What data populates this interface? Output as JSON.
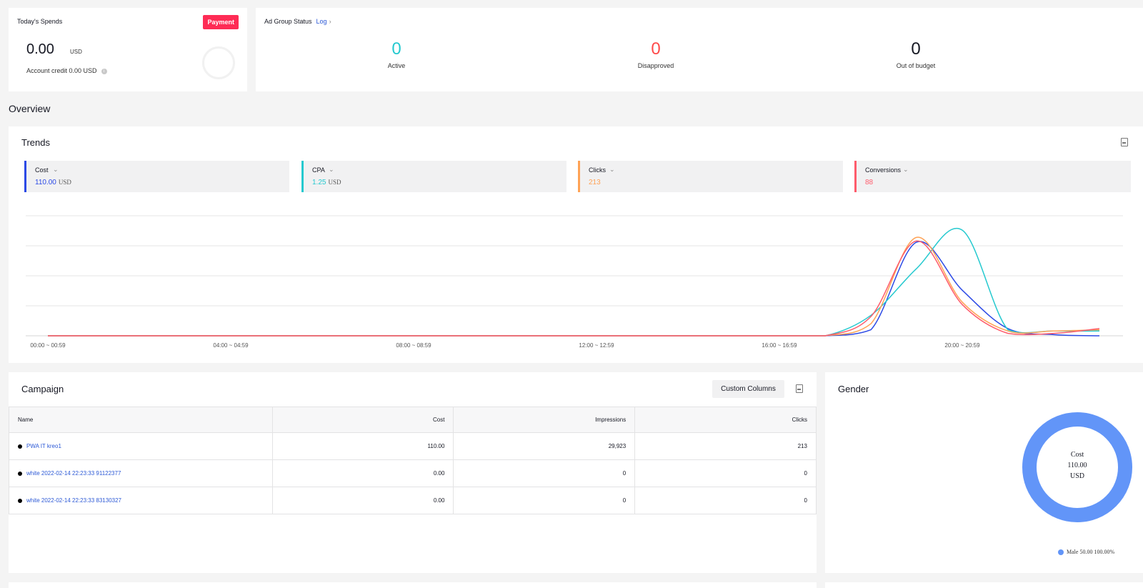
{
  "spend": {
    "title": "Today's Spends",
    "payment_label": "Payment",
    "amount": "0.00",
    "currency": "USD",
    "credit": "Account credit 0.00 USD"
  },
  "status": {
    "title": "Ad Group Status",
    "log_label": "Log",
    "items": [
      {
        "value": "0",
        "label": "Active",
        "color": "#25c9cf"
      },
      {
        "value": "0",
        "label": "Disapproved",
        "color": "#fe4a4a"
      },
      {
        "value": "0",
        "label": "Out of budget",
        "color": "#161823"
      }
    ]
  },
  "overview": {
    "title": "Overview"
  },
  "trends": {
    "title": "Trends",
    "metrics": [
      {
        "name": "Cost",
        "value": "110.00",
        "unit": "USD",
        "color": "#2c4ae6"
      },
      {
        "name": "CPA",
        "value": "1.25",
        "unit": "USD",
        "color": "#25c9cf"
      },
      {
        "name": "Clicks",
        "value": "213",
        "unit": "",
        "color": "#ffa255"
      },
      {
        "name": "Conversions",
        "value": "88",
        "unit": "",
        "color": "#fe5c6c"
      }
    ]
  },
  "chart_data": {
    "type": "line",
    "x_tick_labels": [
      "00:00 ~ 00:59",
      "04:00 ~ 04:59",
      "08:00 ~ 08:59",
      "12:00 ~ 12:59",
      "16:00 ~ 16:59",
      "20:00 ~ 20:59"
    ],
    "x": [
      0,
      1,
      2,
      3,
      4,
      5,
      6,
      7,
      8,
      9,
      10,
      11,
      12,
      13,
      14,
      15,
      16,
      17,
      18,
      19,
      20,
      21,
      22,
      23
    ],
    "grid": true,
    "series": [
      {
        "name": "Cost",
        "color": "#2c4ae6",
        "values": [
          0,
          0,
          0,
          0,
          0,
          0,
          0,
          0,
          0,
          0,
          0,
          0,
          0,
          0,
          0,
          0,
          0,
          0,
          0.05,
          0.78,
          0.38,
          0.06,
          0.01,
          0
        ]
      },
      {
        "name": "CPA",
        "color": "#25c9cf",
        "values": [
          0,
          0,
          0,
          0,
          0,
          0,
          0,
          0,
          0,
          0,
          0,
          0,
          0,
          0,
          0,
          0,
          0,
          0,
          0.17,
          0.56,
          0.88,
          0.05,
          0.04,
          0.04
        ]
      },
      {
        "name": "Clicks",
        "color": "#ffa255",
        "values": [
          0,
          0,
          0,
          0,
          0,
          0,
          0,
          0,
          0,
          0,
          0,
          0,
          0,
          0,
          0,
          0,
          0,
          0,
          0.1,
          0.82,
          0.28,
          0.04,
          0.04,
          0.05
        ]
      },
      {
        "name": "Conversions",
        "color": "#fe5c6c",
        "values": [
          0,
          0,
          0,
          0,
          0,
          0,
          0,
          0,
          0,
          0,
          0,
          0,
          0,
          0,
          0,
          0,
          0,
          0,
          0.16,
          0.79,
          0.26,
          0.02,
          0.02,
          0.06
        ]
      }
    ]
  },
  "campaign": {
    "title": "Campaign",
    "custom_columns_label": "Custom Columns",
    "columns": [
      "Name",
      "Cost",
      "Impressions",
      "Clicks"
    ],
    "rows": [
      {
        "name": "PWA IT kreo1",
        "cost": "110.00",
        "impressions": "29,923",
        "clicks": "213"
      },
      {
        "name": "white 2022-02-14 22:23:33 91122377",
        "cost": "0.00",
        "impressions": "0",
        "clicks": "0"
      },
      {
        "name": "white 2022-02-14 22:23:33 83130327",
        "cost": "0.00",
        "impressions": "0",
        "clicks": "0"
      }
    ]
  },
  "gender": {
    "title": "Gender",
    "center_label": "Cost",
    "center_value": "110.00",
    "center_unit": "USD",
    "legend": "Male 50.00 100.00%",
    "color": "#6295f8"
  }
}
